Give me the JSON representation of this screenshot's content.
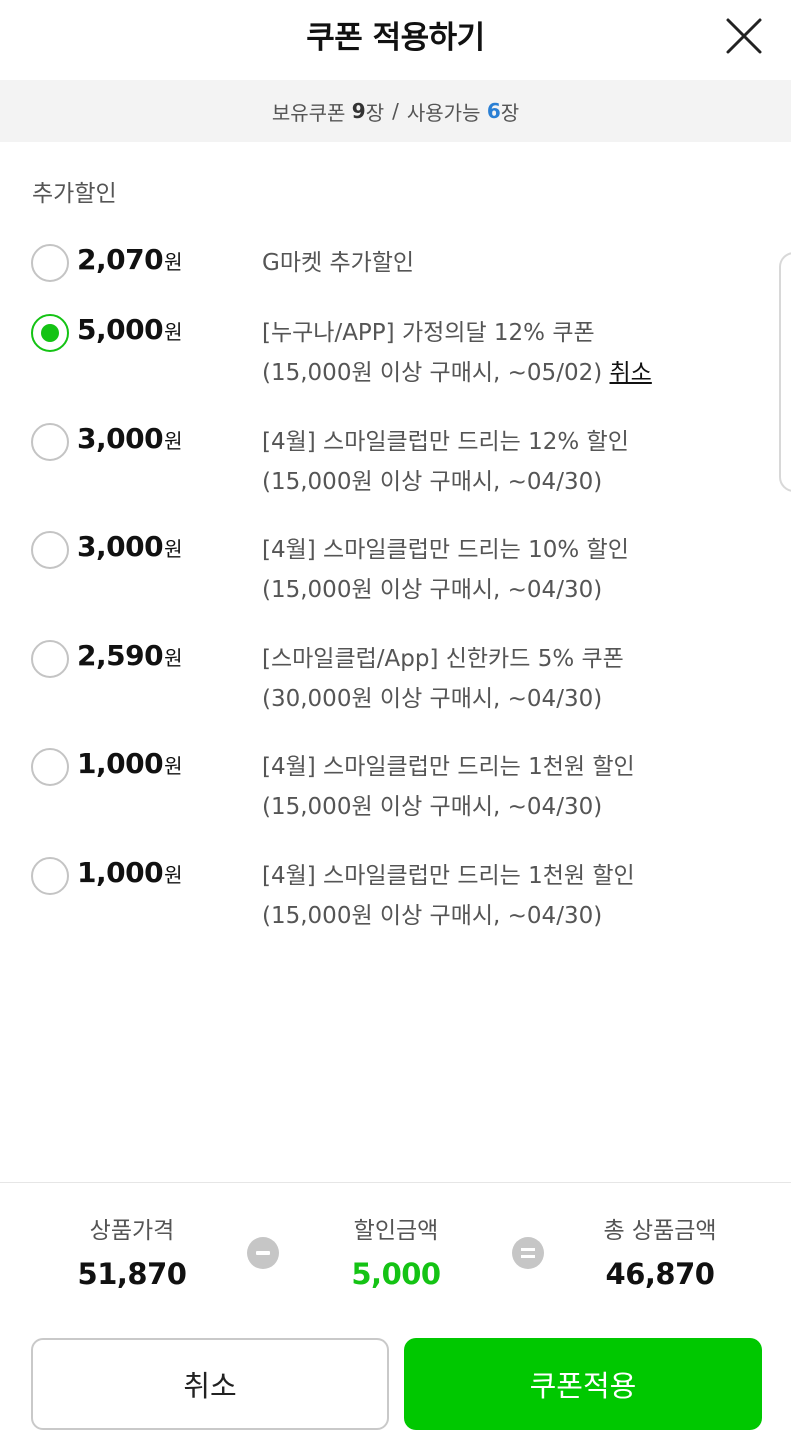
{
  "header": {
    "title": "쿠폰 적용하기",
    "close_icon": "close-icon"
  },
  "summary": {
    "owned_label": "보유쿠폰",
    "owned_count": "9",
    "owned_unit": "장",
    "separator": "/",
    "usable_label": "사용가능",
    "usable_count": "6",
    "usable_unit": "장",
    "usable_color": "#2a7fd4"
  },
  "section": {
    "title": "추가할인"
  },
  "coupons": [
    {
      "amount": "2,070",
      "unit": "원",
      "line1": "G마켓 추가할인",
      "line2": "",
      "selected": false
    },
    {
      "amount": "5,000",
      "unit": "원",
      "line1": "[누구나/APP] 가정의달 12% 쿠폰",
      "line2": "(15,000원 이상 구매시, ~05/02)",
      "cancel": "취소",
      "selected": true
    },
    {
      "amount": "3,000",
      "unit": "원",
      "line1": "[4월] 스마일클럽만 드리는 12% 할인",
      "line2": "(15,000원 이상 구매시, ~04/30)",
      "selected": false
    },
    {
      "amount": "3,000",
      "unit": "원",
      "line1": "[4월] 스마일클럽만 드리는 10% 할인",
      "line2": "(15,000원 이상 구매시, ~04/30)",
      "selected": false
    },
    {
      "amount": "2,590",
      "unit": "원",
      "line1": "[스마일클럽/App] 신한카드 5% 쿠폰",
      "line2": "(30,000원 이상 구매시, ~04/30)",
      "selected": false
    },
    {
      "amount": "1,000",
      "unit": "원",
      "line1": "[4월] 스마일클럽만 드리는 1천원 할인",
      "line2": "(15,000원 이상 구매시, ~04/30)",
      "selected": false
    },
    {
      "amount": "1,000",
      "unit": "원",
      "line1": "[4월] 스마일클럽만 드리는 1천원 할인",
      "line2": "(15,000원 이상 구매시, ~04/30)",
      "selected": false
    }
  ],
  "calc": {
    "price_label": "상품가격",
    "price_value": "51,870",
    "minus_icon": "minus-circle-icon",
    "discount_label": "할인금액",
    "discount_value": "5,000",
    "discount_color": "#14c314",
    "equals_icon": "equals-circle-icon",
    "total_label": "총 상품금액",
    "total_value": "46,870"
  },
  "buttons": {
    "cancel_label": "취소",
    "apply_label": "쿠폰적용",
    "apply_color": "#00c800"
  }
}
